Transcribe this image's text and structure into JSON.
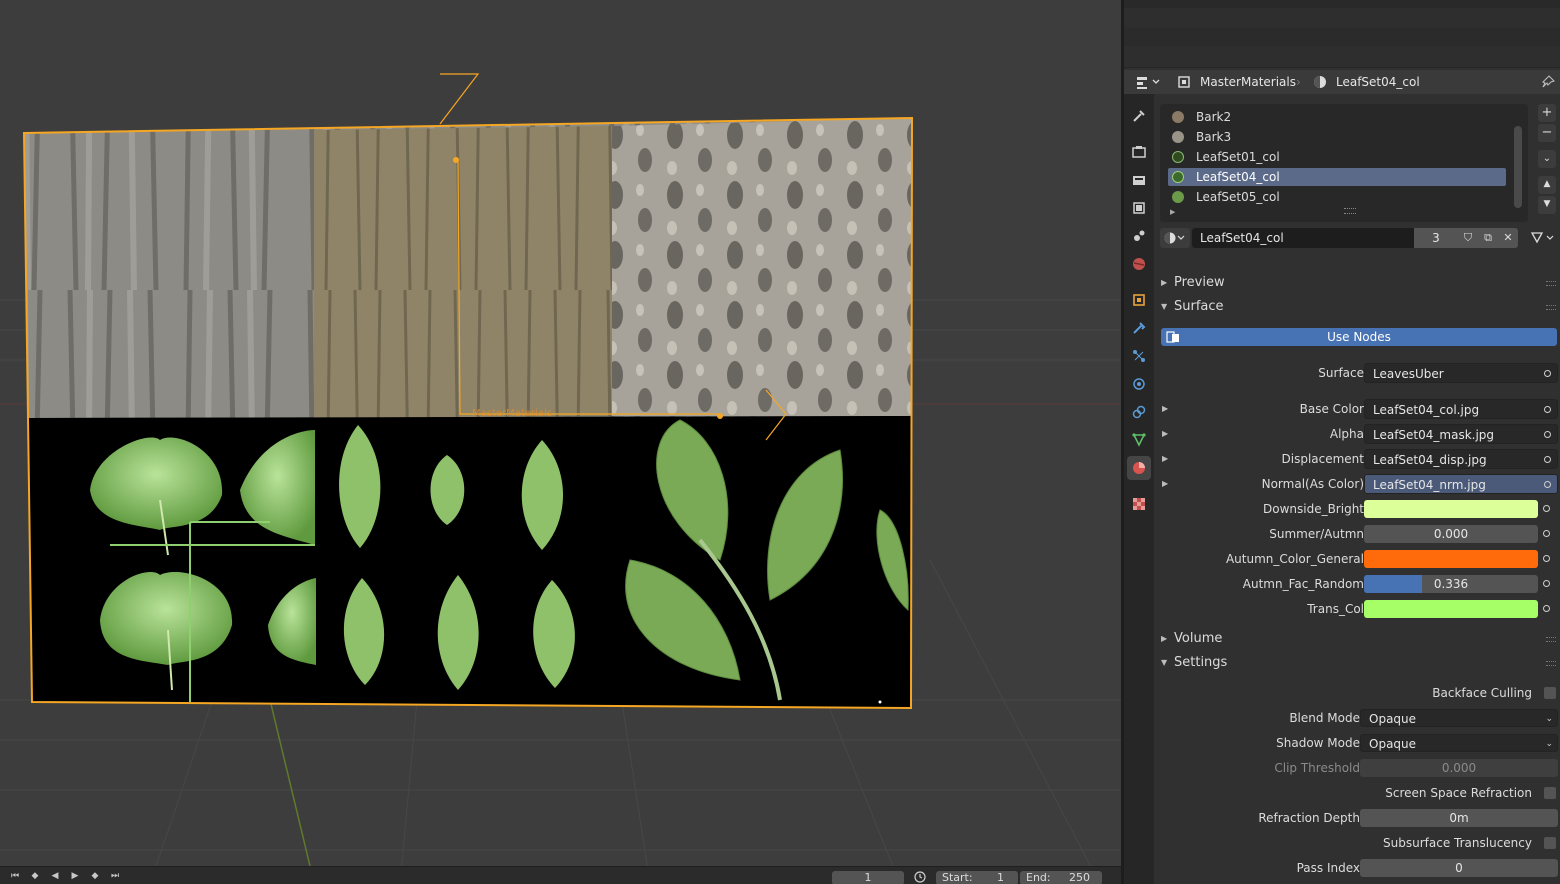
{
  "viewport": {
    "object_label": "MasterMaterials",
    "timeline": {
      "current_frame": "1",
      "start_label": "Start:",
      "start_value": "1",
      "end_label": "End:",
      "end_value": "250"
    }
  },
  "properties": {
    "header": {
      "object_name": "MasterMaterials",
      "material_name": "LeafSet04_col"
    },
    "material_slots": [
      {
        "name": "Bark2",
        "color": "#8a7a66",
        "selected": false
      },
      {
        "name": "Bark3",
        "color": "#9a9488",
        "selected": false
      },
      {
        "name": "LeafSet01_col",
        "color": "#2f4a1f",
        "selected": false
      },
      {
        "name": "LeafSet04_col",
        "color": "#3c6a2a",
        "selected": true
      },
      {
        "name": "LeafSet05_col",
        "color": "#6a9a4a",
        "selected": false
      }
    ],
    "datablock": {
      "name": "LeafSet04_col",
      "users": "3"
    },
    "sections": {
      "preview": "Preview",
      "surface": "Surface",
      "volume": "Volume",
      "settings": "Settings"
    },
    "use_nodes_label": "Use Nodes",
    "surface": {
      "label": "Surface",
      "value": "LeavesUber"
    },
    "inputs": [
      {
        "label": "Base Color",
        "value": "LeafSet04_col.jpg"
      },
      {
        "label": "Alpha",
        "value": "LeafSet04_mask.jpg"
      },
      {
        "label": "Displacement",
        "value": "LeafSet04_disp.jpg"
      },
      {
        "label": "Normal(As Color)",
        "value": "LeafSet04_nrm.jpg"
      }
    ],
    "params": {
      "downside_bright": {
        "label": "Downside_Bright",
        "color": "#ddff99"
      },
      "summer_autumn": {
        "label": "Summer/Autmn",
        "value": "0.000"
      },
      "autumn_color": {
        "label": "Autumn_Color_General",
        "color": "#ff6a0a"
      },
      "autumn_fac": {
        "label": "Autmn_Fac_Random",
        "value": "0.336",
        "fraction": 0.336
      },
      "trans_col": {
        "label": "Trans_Col",
        "color": "#a6ff66"
      }
    },
    "settings": {
      "backface_culling": "Backface Culling",
      "blend_mode_label": "Blend Mode",
      "blend_mode": "Opaque",
      "shadow_mode_label": "Shadow Mode",
      "shadow_mode": "Opaque",
      "clip_threshold_label": "Clip Threshold",
      "clip_threshold": "0.000",
      "ssr": "Screen Space Refraction",
      "refraction_depth_label": "Refraction Depth",
      "refraction_depth": "0m",
      "subsurface": "Subsurface Translucency",
      "pass_index_label": "Pass Index",
      "pass_index": "0"
    }
  }
}
